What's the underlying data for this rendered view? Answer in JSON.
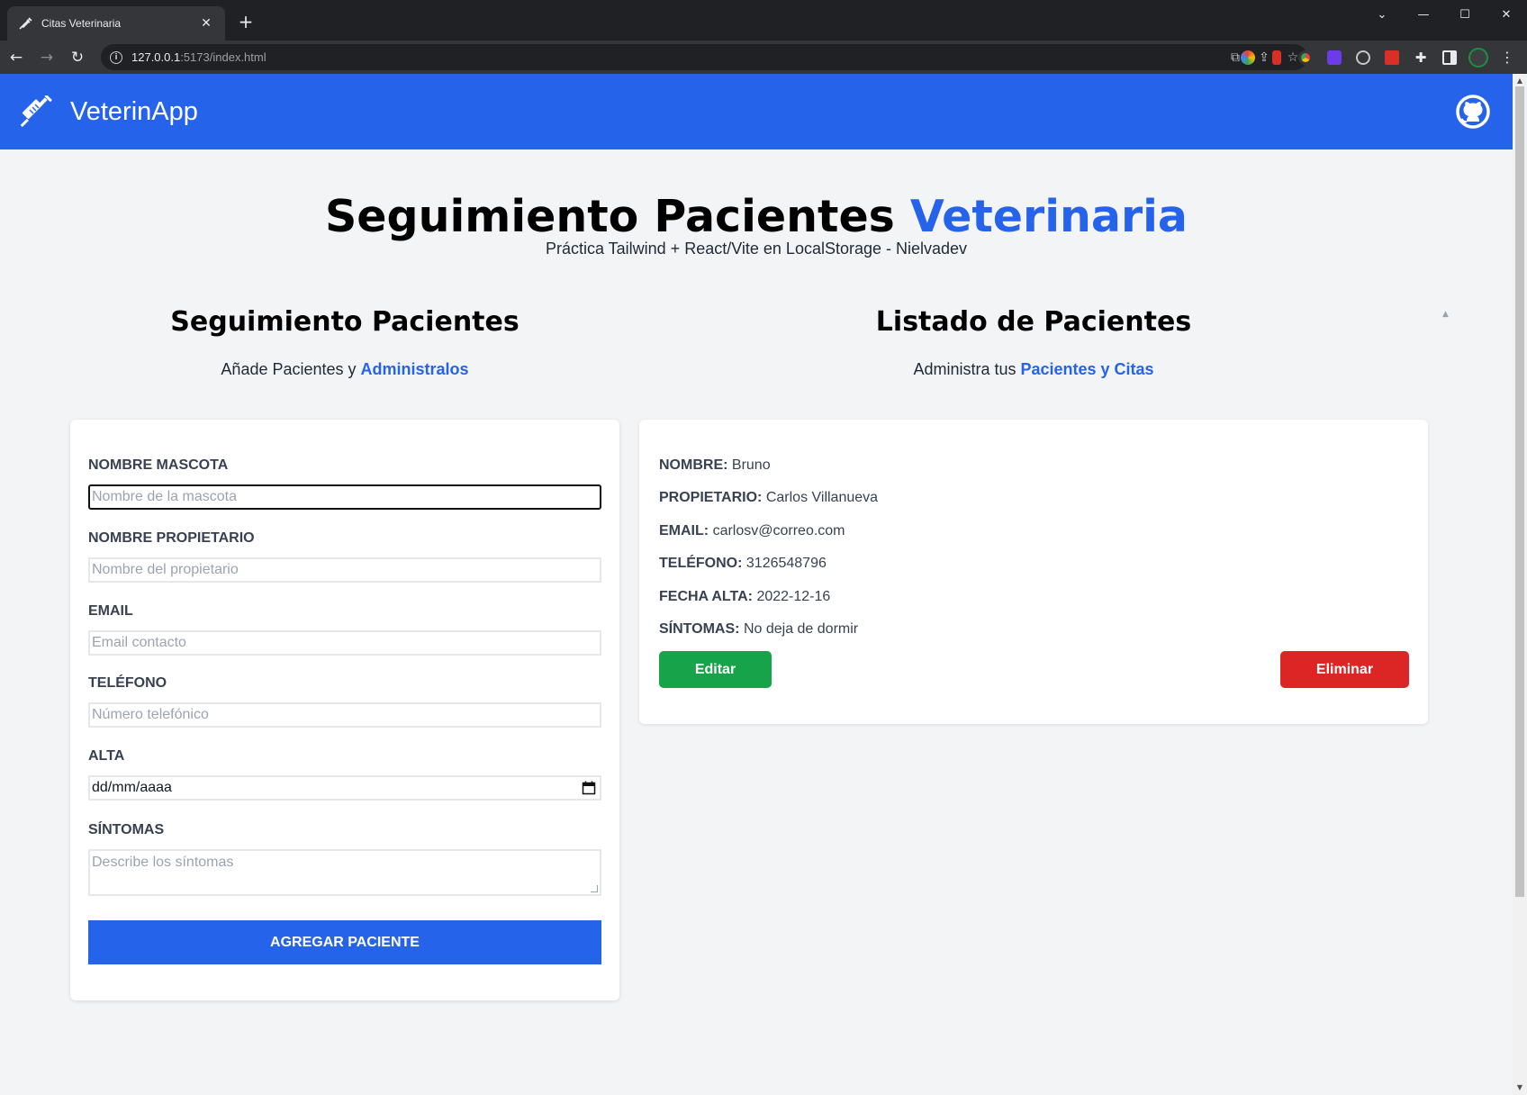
{
  "browser": {
    "tab_title": "Citas Veterinaria",
    "tab_close": "✕",
    "new_tab": "+",
    "url_host": "127.0.0.1",
    "url_path": ":5173/index.html",
    "win_min": "—",
    "win_max": "☐",
    "win_close": "✕",
    "win_dropdown": "⌄"
  },
  "header": {
    "brand": "VeterinApp",
    "color": "#2563eb"
  },
  "hero": {
    "title_main": "Seguimiento Pacientes ",
    "title_accent": "Veterinaria",
    "subtitle": "Práctica Tailwind + React/Vite en LocalStorage - Nielvadev"
  },
  "form_section": {
    "title": "Seguimiento Pacientes",
    "sub_prefix": "Añade Pacientes y ",
    "sub_highlight": "Administralos"
  },
  "list_section": {
    "title": "Listado de Pacientes",
    "sub_prefix": "Administra tus ",
    "sub_highlight": "Pacientes y Citas"
  },
  "form": {
    "pet_label": "NOMBRE MASCOTA",
    "pet_placeholder": "Nombre de la mascota",
    "owner_label": "NOMBRE PROPIETARIO",
    "owner_placeholder": "Nombre del propietario",
    "email_label": "EMAIL",
    "email_placeholder": "Email contacto",
    "phone_label": "TELÉFONO",
    "phone_placeholder": "Número telefónico",
    "date_label": "ALTA",
    "date_value": "dd/mm/aaaa",
    "symptoms_label": "SÍNTOMAS",
    "symptoms_placeholder": "Describe los síntomas",
    "submit": "AGREGAR PACIENTE"
  },
  "patient": {
    "name_label": "NOMBRE:",
    "name": "Bruno",
    "owner_label": "PROPIETARIO:",
    "owner": "Carlos Villanueva",
    "email_label": "EMAIL:",
    "email": "carlosv@correo.com",
    "phone_label": "TELÉFONO:",
    "phone": "3126548796",
    "date_label": "FECHA ALTA:",
    "date": "2022-12-16",
    "symptoms_label": "SÍNTOMAS:",
    "symptoms": "No deja de dormir",
    "edit": "Editar",
    "delete": "Eliminar"
  },
  "colors": {
    "primary": "#2563eb",
    "edit": "#16a34a",
    "delete": "#dc2626"
  }
}
